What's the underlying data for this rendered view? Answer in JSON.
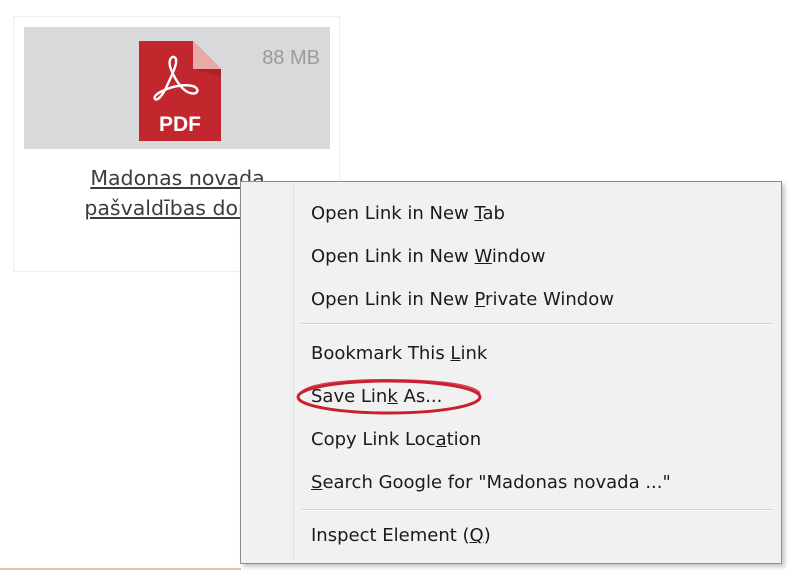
{
  "file_card": {
    "size": "88 MB",
    "icon_label": "PDF",
    "link_line1": "Madonas novada",
    "link_line2": "pašvaldības dome"
  },
  "context_menu": {
    "groups": [
      [
        {
          "before": "Open Link in New ",
          "key": "T",
          "after": "ab"
        },
        {
          "before": "Open Link in New ",
          "key": "W",
          "after": "indow"
        },
        {
          "before": "Open Link in New ",
          "key": "P",
          "after": "rivate Window"
        }
      ],
      [
        {
          "before": "Bookmark This ",
          "key": "L",
          "after": "ink"
        },
        {
          "before": "Save Lin",
          "key": "k",
          "after": " As..."
        },
        {
          "before": "Copy Link Loc",
          "key": "a",
          "after": "tion"
        },
        {
          "before": "",
          "key": "S",
          "after": "earch Google for \"Madonas novada ...\""
        }
      ],
      [
        {
          "before": "Inspect Element (",
          "key": "Q",
          "after": ")"
        }
      ]
    ]
  },
  "colors": {
    "thumb_background": "#d8d9da",
    "pdf_red": "#c1272d",
    "menu_background": "#f1f1f1",
    "highlight": "#c8202e"
  },
  "icons": {
    "file": "pdf-file-icon"
  }
}
